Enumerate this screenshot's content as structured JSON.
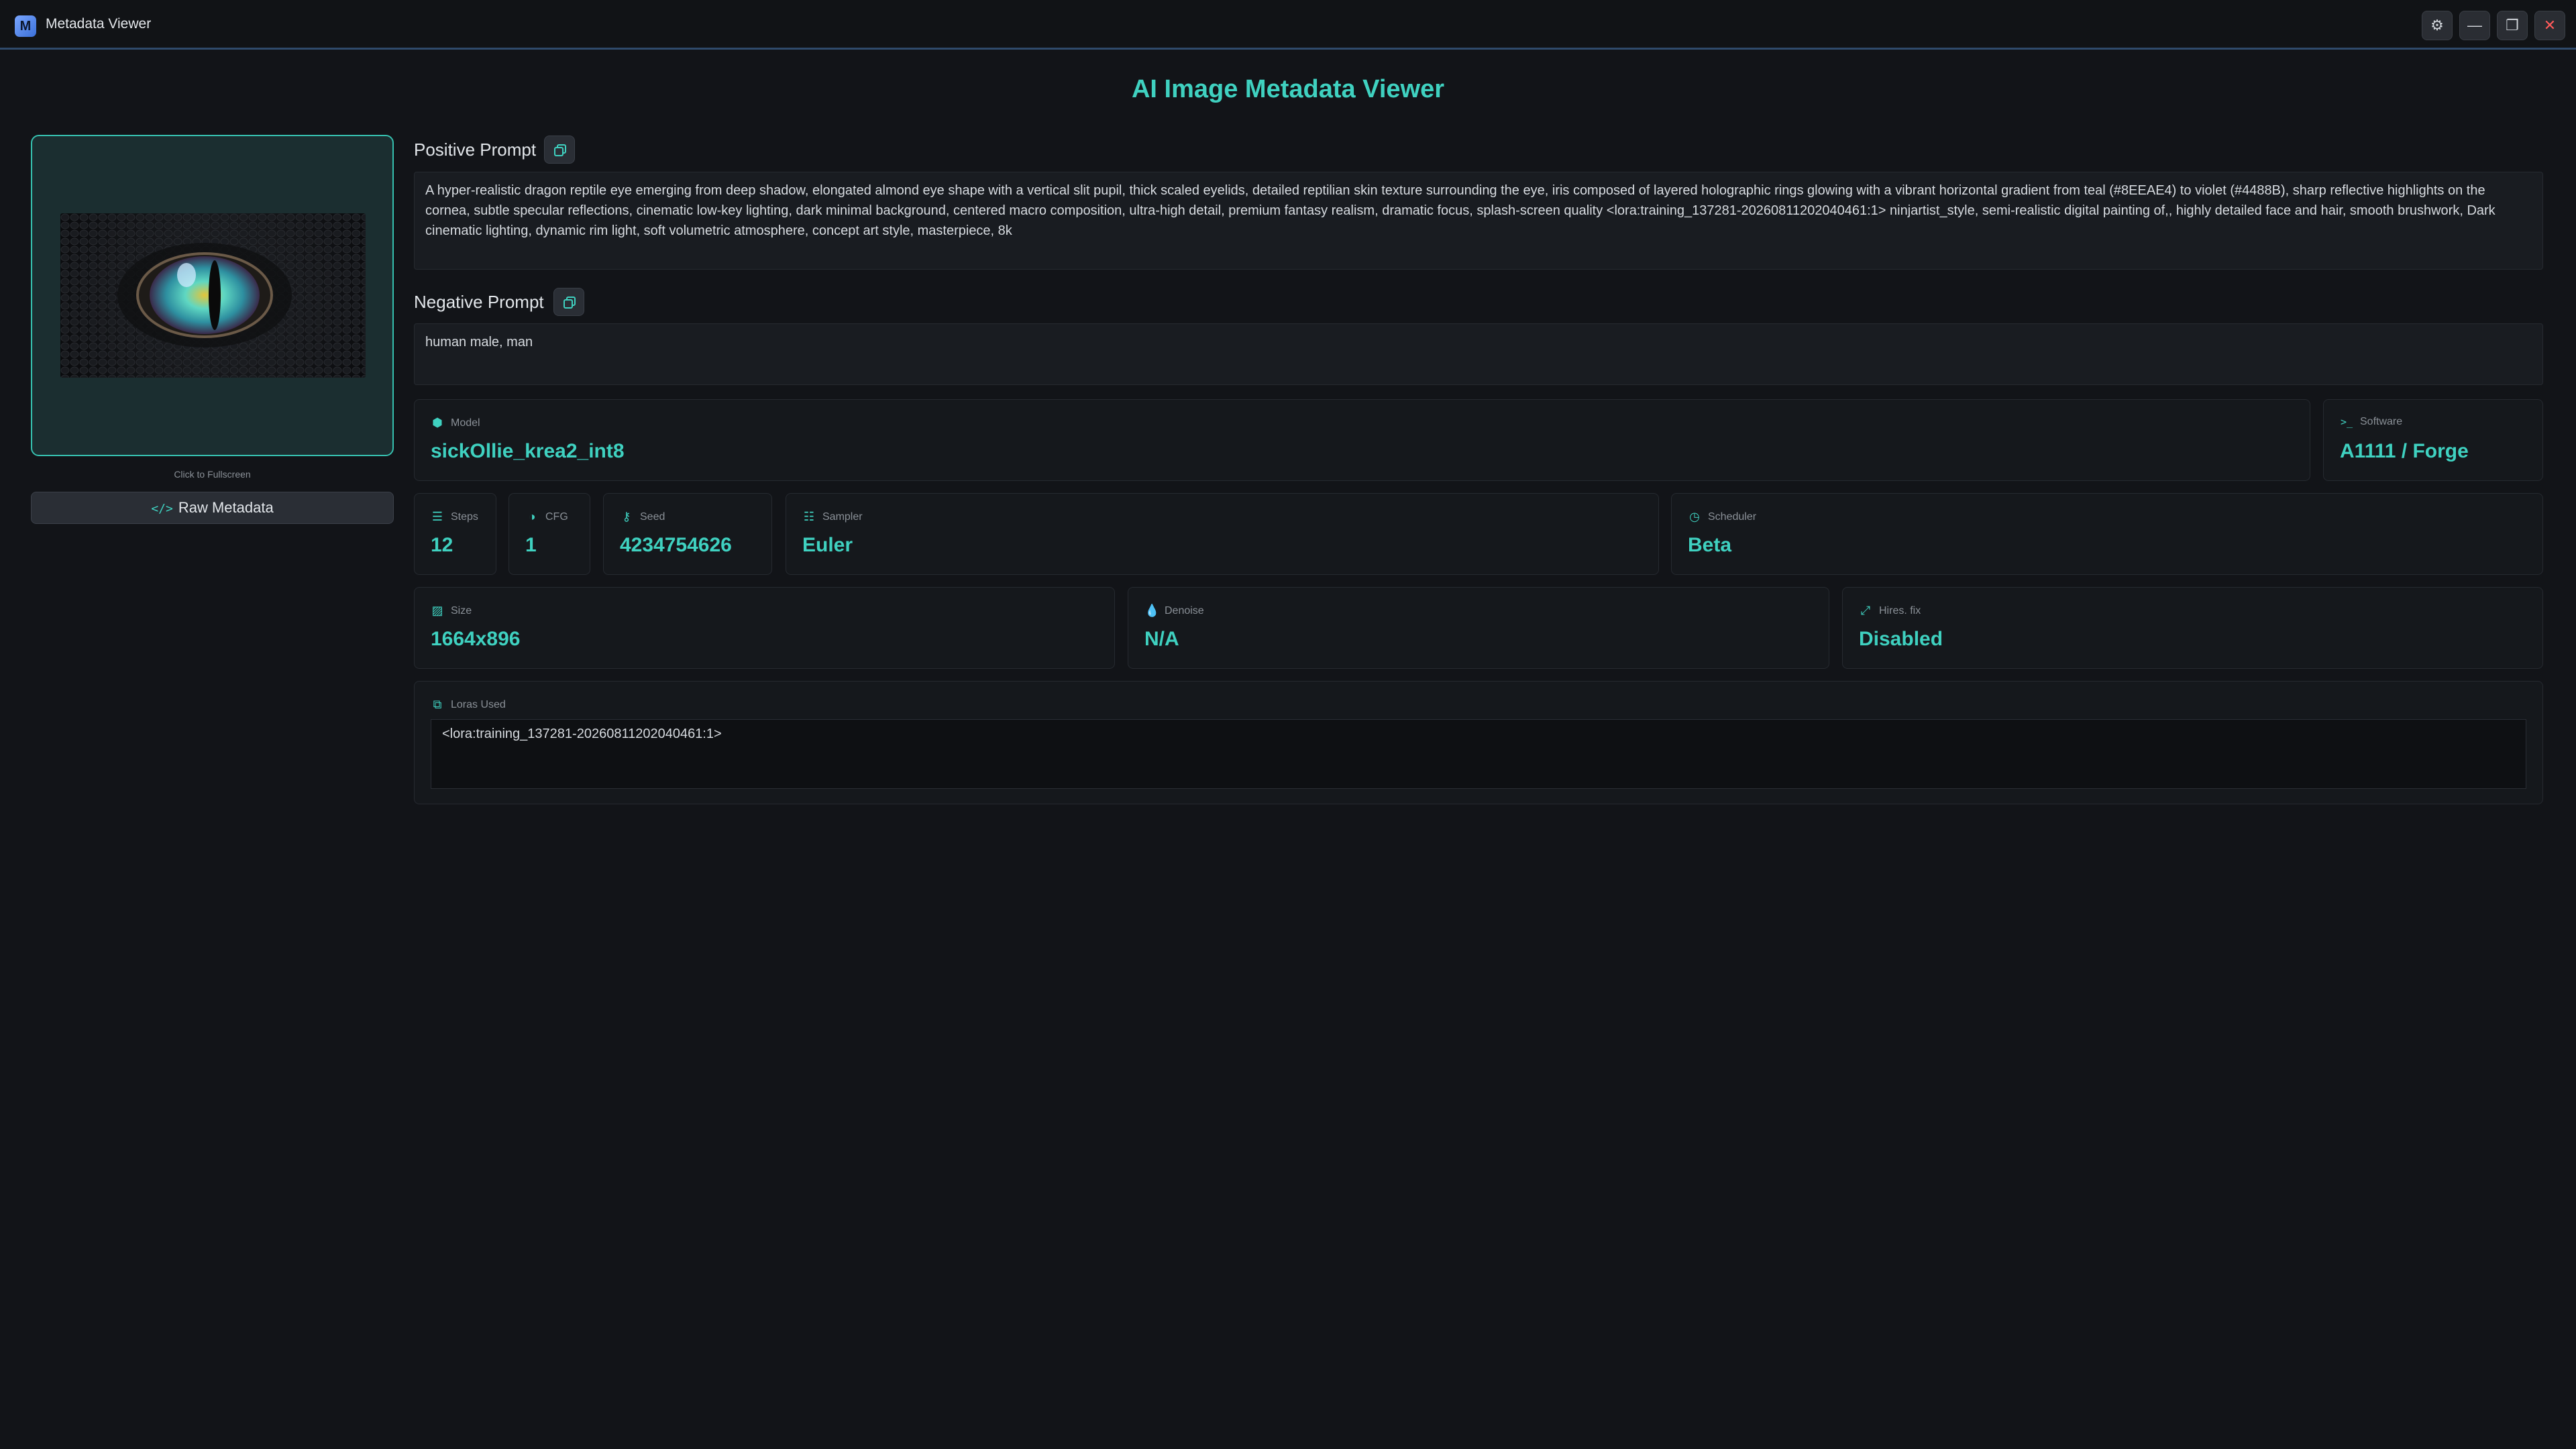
{
  "window": {
    "title": "Metadata Viewer",
    "icon_letter": "M",
    "buttons": {
      "settings": "⚙",
      "minimize": "—",
      "restore": "❐",
      "close": "✕"
    }
  },
  "page_title": "AI Image Metadata Viewer",
  "image_panel": {
    "hint": "Click to Fullscreen",
    "raw_button": "Raw Metadata",
    "raw_icon": "</>"
  },
  "positive_prompt": {
    "label": "Positive Prompt",
    "text": "A hyper-realistic dragon reptile eye emerging from deep shadow, elongated almond eye shape with a vertical slit pupil, thick scaled eyelids, detailed reptilian skin texture surrounding the eye, iris composed of layered holographic rings glowing with a vibrant horizontal gradient from teal (#8EEAE4) to violet (#4488B), sharp reflective highlights on the cornea, subtle specular reflections, cinematic low-key lighting, dark minimal background, centered macro composition, ultra-high detail, premium fantasy realism, dramatic focus, splash-screen quality <lora:training_137281-20260811202040461:1> ninjartist_style, semi-realistic digital painting of,, highly detailed face and hair, smooth brushwork, Dark cinematic lighting, dynamic rim light, soft volumetric atmosphere, concept art style, masterpiece, 8k"
  },
  "negative_prompt": {
    "label": "Negative Prompt",
    "text": "human male, man"
  },
  "cards": {
    "model": {
      "label": "Model",
      "value": "sickOllie_krea2_int8",
      "icon": "cube-icon"
    },
    "software": {
      "label": "Software",
      "value": "A1111 / Forge",
      "icon": "terminal-icon"
    },
    "steps": {
      "label": "Steps",
      "value": "12",
      "icon": "list-icon"
    },
    "cfg": {
      "label": "CFG",
      "value": "1",
      "icon": "contrast-icon"
    },
    "seed": {
      "label": "Seed",
      "value": "4234754626",
      "icon": "key-icon"
    },
    "sampler": {
      "label": "Sampler",
      "value": "Euler",
      "icon": "sliders-icon"
    },
    "scheduler": {
      "label": "Scheduler",
      "value": "Beta",
      "icon": "clock-icon"
    },
    "size": {
      "label": "Size",
      "value": "1664x896",
      "icon": "image-icon"
    },
    "denoise": {
      "label": "Denoise",
      "value": "N/A",
      "icon": "droplet-icon"
    },
    "hires": {
      "label": "Hires. fix",
      "value": "Disabled",
      "icon": "expand-icon"
    },
    "loras": {
      "label": "Loras Used",
      "value": "<lora:training_137281-20260811202040461:1>",
      "icon": "puzzle-icon"
    }
  },
  "colors": {
    "accent": "#3fd1c0",
    "background": "#121418",
    "titlebar_border": "#2f4a6b"
  }
}
